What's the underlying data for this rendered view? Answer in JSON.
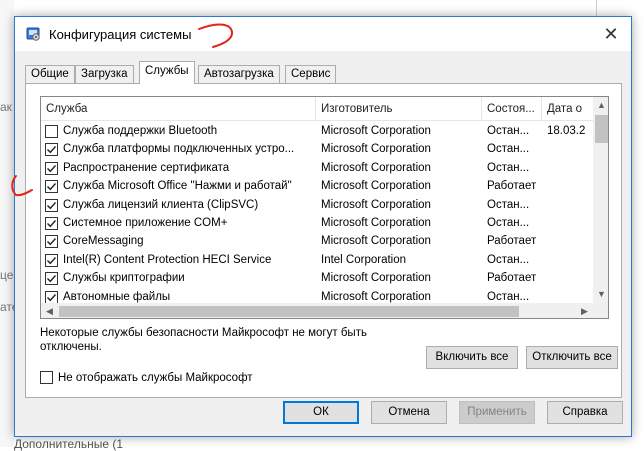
{
  "background": {
    "fragments": [
      "ак",
      "це",
      "ате"
    ],
    "bottom_text": "Дополнительные (1"
  },
  "window": {
    "title": "Конфигурация системы",
    "close_label": "✕"
  },
  "tabs": [
    {
      "label": "Общие",
      "active": false
    },
    {
      "label": "Загрузка",
      "active": false
    },
    {
      "label": "Службы",
      "active": true
    },
    {
      "label": "Автозагрузка",
      "active": false
    },
    {
      "label": "Сервис",
      "active": false
    }
  ],
  "services": {
    "columns": [
      "Служба",
      "Изготовитель",
      "Состоя...",
      "Дата о"
    ],
    "rows": [
      {
        "checked": false,
        "name": "Служба поддержки Bluetooth",
        "vendor": "Microsoft Corporation",
        "status": "Остан...",
        "date": "18.03.2"
      },
      {
        "checked": true,
        "name": "Служба платформы подключенных устро...",
        "vendor": "Microsoft Corporation",
        "status": "Остан...",
        "date": ""
      },
      {
        "checked": true,
        "name": "Распространение сертификата",
        "vendor": "Microsoft Corporation",
        "status": "Остан...",
        "date": ""
      },
      {
        "checked": true,
        "name": "Служба Microsoft Office \"Нажми и работай\"",
        "vendor": "Microsoft Corporation",
        "status": "Работает",
        "date": ""
      },
      {
        "checked": true,
        "name": "Служба лицензий клиента (ClipSVC)",
        "vendor": "Microsoft Corporation",
        "status": "Остан...",
        "date": ""
      },
      {
        "checked": true,
        "name": "Системное приложение COM+",
        "vendor": "Microsoft Corporation",
        "status": "Остан...",
        "date": ""
      },
      {
        "checked": true,
        "name": "CoreMessaging",
        "vendor": "Microsoft Corporation",
        "status": "Работает",
        "date": ""
      },
      {
        "checked": true,
        "name": "Intel(R) Content Protection HECI Service",
        "vendor": "Intel Corporation",
        "status": "Остан...",
        "date": ""
      },
      {
        "checked": true,
        "name": "Службы криптографии",
        "vendor": "Microsoft Corporation",
        "status": "Работает",
        "date": ""
      },
      {
        "checked": true,
        "name": "Автономные файлы",
        "vendor": "Microsoft Corporation",
        "status": "Остан...",
        "date": ""
      }
    ]
  },
  "notice": "Некоторые службы безопасности Майкрософт не могут быть отключены.",
  "buttons": {
    "enable_all": "Включить все",
    "disable_all": "Отключить все",
    "ok": "ОК",
    "cancel": "Отмена",
    "apply": "Применить",
    "help": "Справка"
  },
  "hide_ms": {
    "label": "Не отображать службы Майкрософт",
    "checked": false
  },
  "colors": {
    "window_border": "#2b78d4",
    "annotation_red": "#e0261b",
    "default_button": "#0078d7"
  }
}
